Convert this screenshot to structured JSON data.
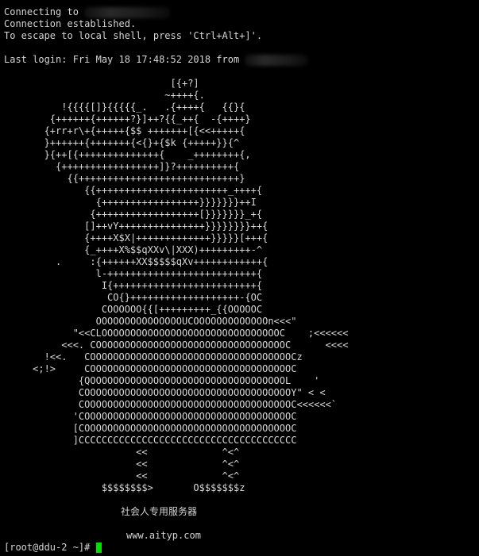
{
  "session": {
    "line1": "Connecting to",
    "line2": "Connection established.",
    "line3": "To escape to local shell, press 'Ctrl+Alt+]'.",
    "last_login": "Last login: Fri May 18 17:48:52 2018 from"
  },
  "banner": {
    "art_lines": [
      "                             [{+?]",
      "                            ~++++{.",
      "          !{{{{[]}{{{{{_.   .{++++{   {{}{",
      "        {++++++{++++++?}]++?{{_++{  -{++++}",
      "       {+rr+r\\+{+++++{$$ +++++++[{<<+++++{",
      "       }++++++{+++++++{<{}+{$k {+++++}}{^",
      "       }{++[{++++++++++++++{    _++++++++{,",
      "         {+++++++++++++++++]}?++++++++++{",
      "           {{++++++++++++++++++++++++++++}",
      "              {{+++++++++++++++++++++++_++++{",
      "                {+++++++++++++++++}}}}}}}++I",
      "               {++++++++++++++++++[}}}}}}}_+{",
      "              []++vY+++++++++++++++}}}}}}}}++{",
      "              {++++X$X|+++++++++++++}}}}}[+++{",
      "              {_++++X%$$qXXv\\|XXX)+++++++++-^",
      "         .     :{++++++XX$$$$$qXv++++++++++++{",
      "                l-++++++++++++++++++++++++++{",
      "                 I{+++++++++++++++++++++++++{",
      "                  CO{}+++++++++++++++++++-{OC",
      "                 COOOOOO{{[+++++++++_{{OOOOOC",
      "                OOOOOOOOOOOOOOOUCOOOOOOOOOOOOOn<<<\"",
      "            \"<<CLOOOOOOOOOOOOOOOOOOOOOOOOOOOOOOOC    ;<<<<<<",
      "          <<<. COOOOOOOOOOOOOOOOOOOOOOOOOOOOOOOOOC      <<<<",
      "       !<<.   COOOOOOOOOOOOOOOOOOOOOOOOOOOOOOOOOOOCz",
      "     <;!>     COOOOOOOOOOOOOOOOOOOOOOOOOOOOOOOOOOOC",
      "             {QOOOOOOOOOOOOOOOOOOOOOOOOOOOOOOOOOOL    '",
      "             COOOOOOOOOOOOOOOOOOOOOOOOOOOOOOOOOOOOY\" < <",
      "             COOOOOOOOOOOOOOOOOOOOOOOOOOOOOOOOOOOOC<<<<<<`",
      "            'COOOOOOOOOOOOOOOOOOOOOOOOOOOOOOOOOOOOC",
      "            [COOOOOOOOOOOOOOOOOOOOOOOOOOOOOOOOOOOOC",
      "            ]CCCCCCCCCCCCCCCCCCCCCCCCCCCCCCCCCCCCCC",
      "                       <<             ^<^",
      "                       <<             ^<^",
      "                       <<             ^<^",
      "                 $$$$$$$$>       O$$$$$$$z"
    ],
    "caption": "社会人专用服务器",
    "website": "www.aityp.com"
  },
  "prompt": {
    "text": "[root@ddu-2 ~]# "
  },
  "colors": {
    "background": "#000000",
    "foreground": "#d4d4d4",
    "cursor": "#00e000"
  }
}
